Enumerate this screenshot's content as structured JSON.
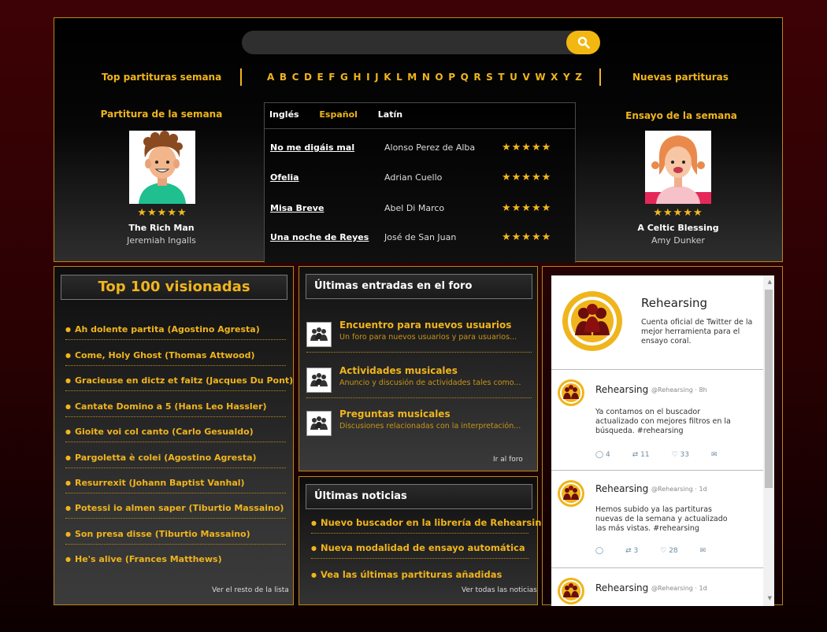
{
  "search": {
    "placeholder": ""
  },
  "nav": {
    "top_week": "Top partituras semana",
    "alphabet": "A B C D E F G H I J K L M N O P Q R S T U V W X Y Z",
    "new_scores": "Nuevas partituras"
  },
  "score_of_week": {
    "heading": "Partitura de la semana",
    "title": "The Rich Man",
    "composer": "Jeremiah Ingalls",
    "stars": "★★★★★",
    "rating": 5
  },
  "rehearsal_of_week": {
    "heading": "Ensayo de la semana",
    "title": "A Celtic Blessing",
    "composer": "Amy Dunker",
    "stars": "★★★★★",
    "rating": 5
  },
  "tabs": [
    "Inglés",
    "Español",
    "Latín"
  ],
  "scores": [
    {
      "title": "No me digáis mal",
      "composer": "Alonso Perez de Alba",
      "stars": "★★★★★"
    },
    {
      "title": "Ofelia",
      "composer": "Adrian Cuello",
      "stars": "★★★★★"
    },
    {
      "title": "Misa Breve",
      "composer": "Abel Di Marco",
      "stars": "★★★★★"
    },
    {
      "title": "Una noche de Reyes",
      "composer": "José de San Juan",
      "stars": "★★★★★"
    }
  ],
  "top100": {
    "heading": "Top 100 visionadas",
    "items": [
      "Ah dolente partita (Agostino Agresta)",
      "Come, Holy Ghost (Thomas Attwood)",
      "Gracieuse en dictz et faitz (Jacques Du Pont)",
      "Cantate Domino a 5 (Hans Leo Hassler)",
      "Gioite voi col canto (Carlo Gesualdo)",
      "Pargoletta è colei (Agostino Agresta)",
      "Resurrexit (Johann Baptist Vanhal)",
      "Potessi io almen saper (Tiburtio Massaino)",
      "Son presa disse (Tiburtio Massaino)",
      "He's alive (Frances Matthews)"
    ],
    "more": "Ver el resto de la lista"
  },
  "forum": {
    "heading": "Últimas entradas en el foro",
    "items": [
      {
        "title": "Encuentro para nuevos usuarios",
        "desc": "Un foro para nuevos usuarios y para usuarios..."
      },
      {
        "title": "Actividades musicales",
        "desc": "Anuncio y discusión de actividades tales como..."
      },
      {
        "title": "Preguntas musicales",
        "desc": "Discusiones relacionadas con la interpretación..."
      }
    ],
    "more": "Ir al foro"
  },
  "news": {
    "heading": "Últimas noticias",
    "items": [
      "Nuevo buscador en la librería de Rehearsing",
      "Nueva modalidad de ensayo automática",
      "Vea las últimas partituras añadidas"
    ],
    "more": "Ver todas las noticias"
  },
  "twitter": {
    "name": "Rehearsing",
    "bio": "Cuenta oficial de Twitter de la mejor herramienta para el ensayo coral.",
    "tweets": [
      {
        "name": "Rehearsing",
        "meta": "@Rehearsing · 8h",
        "text": "Ya contamos on el buscador actualizado con mejores filtros en la búsqueda. #rehearsing",
        "replies": "4",
        "retweets": "11",
        "likes": "33"
      },
      {
        "name": "Rehearsing",
        "meta": "@Rehearsing · 1d",
        "text": "Hemos subido ya las partituras nuevas de la semana y actualizado las más vistas. #rehearsing",
        "replies": "",
        "retweets": "3",
        "likes": "28"
      },
      {
        "name": "Rehearsing",
        "meta": "@Rehearsing · 1d",
        "text": "",
        "replies": "",
        "retweets": "",
        "likes": ""
      }
    ]
  }
}
